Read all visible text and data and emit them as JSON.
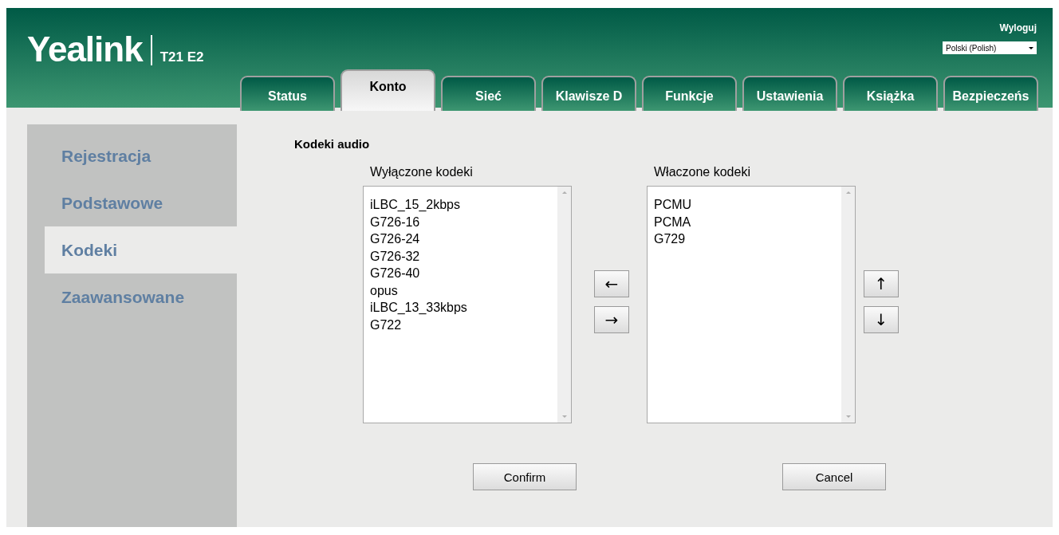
{
  "header": {
    "logo": "Yealink",
    "model": "T21 E2",
    "logout": "Wyloguj",
    "language": "Polski (Polish)"
  },
  "tabs": [
    {
      "label": "Status",
      "selected": false
    },
    {
      "label": "Konto",
      "selected": true
    },
    {
      "label": "Sieć",
      "selected": false
    },
    {
      "label": "Klawisze D",
      "selected": false
    },
    {
      "label": "Funkcje",
      "selected": false
    },
    {
      "label": "Ustawienia",
      "selected": false
    },
    {
      "label": "Książka",
      "selected": false
    },
    {
      "label": "Bezpieczeńs",
      "selected": false
    }
  ],
  "sidebar": {
    "items": [
      {
        "label": "Rejestracja",
        "selected": false
      },
      {
        "label": "Podstawowe",
        "selected": false
      },
      {
        "label": "Kodeki",
        "selected": true
      },
      {
        "label": "Zaawansowane",
        "selected": false
      }
    ]
  },
  "section_title": "Kodeki audio",
  "disabled_codecs": {
    "label": "Wyłączone kodeki",
    "items": [
      "iLBC_15_2kbps",
      "G726-16",
      "G726-24",
      "G726-32",
      "G726-40",
      "opus",
      "iLBC_13_33kbps",
      "G722"
    ]
  },
  "move_buttons": [
    "←",
    "→"
  ],
  "enabled_codecs": {
    "label": "Właczone kodeki",
    "items": [
      "PCMU",
      "PCMA",
      "G729"
    ]
  },
  "order_buttons": [
    "↑",
    "↓"
  ],
  "buttons": [
    "Confirm",
    "Cancel"
  ]
}
